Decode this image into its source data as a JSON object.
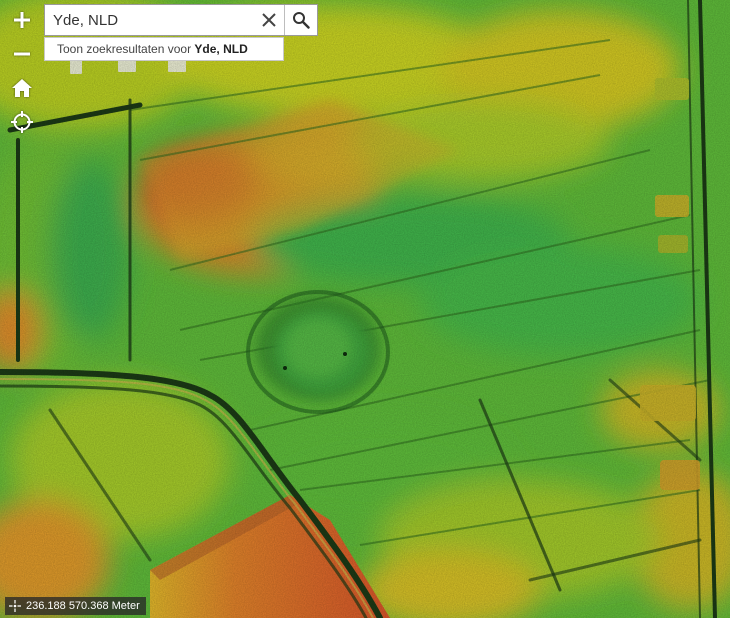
{
  "search": {
    "value": "Yde, NLD",
    "placeholder": "",
    "suggestion_prefix": "Toon zoekresultaten voor",
    "suggestion_term": "Yde, NLD"
  },
  "controls": {
    "zoom_in": "+",
    "zoom_out": "−"
  },
  "coordinates": {
    "text": "236.188 570.368 Meter"
  },
  "map": {
    "style": "elevation hillshade (AHN)",
    "colors": {
      "low": "#2fb04a",
      "mid_low": "#66c030",
      "mid": "#c8d21e",
      "mid_high": "#e0a624",
      "high": "#d8552a"
    }
  }
}
